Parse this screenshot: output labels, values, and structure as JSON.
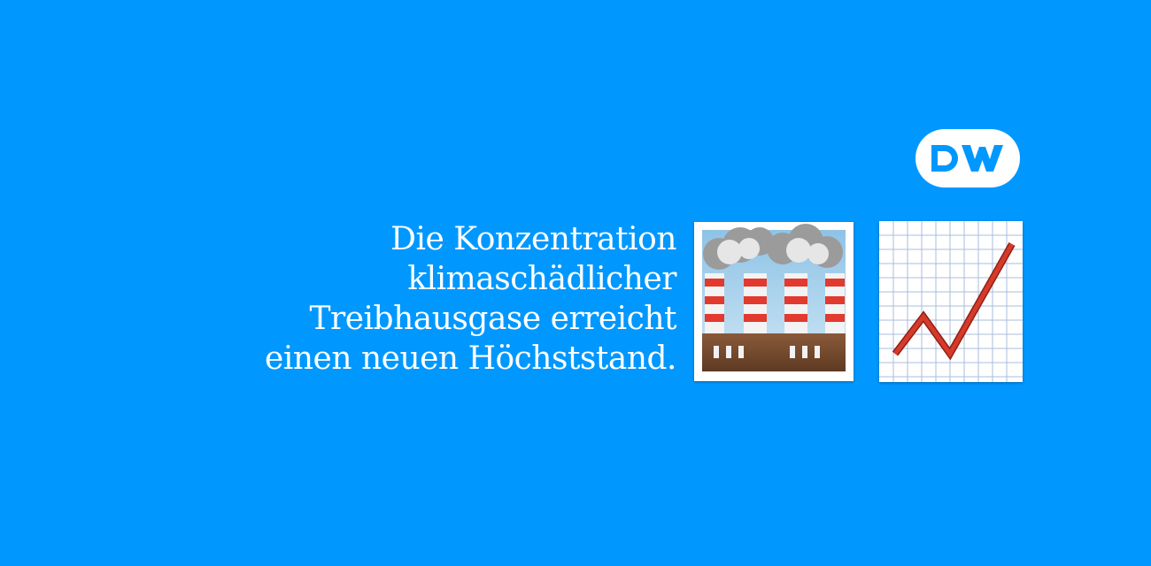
{
  "logo": {
    "text": "DW",
    "colors": {
      "ring": "#FFFFFF",
      "letters": "#0098FF"
    }
  },
  "headline": {
    "lines": [
      "Die Konzentration",
      "klimaschädlicher",
      "Treibhausgase erreicht",
      "einen neuen Höchststand."
    ]
  },
  "icons": {
    "factory": "factory-emoji-icon",
    "chart": "chart-increasing-emoji-icon"
  },
  "colors": {
    "background": "#0098FF",
    "text": "#FFFFFF",
    "chimney_stripe": "#E23A2E",
    "trend_line": "#D63A2A",
    "grid": "#9FB3D8"
  }
}
